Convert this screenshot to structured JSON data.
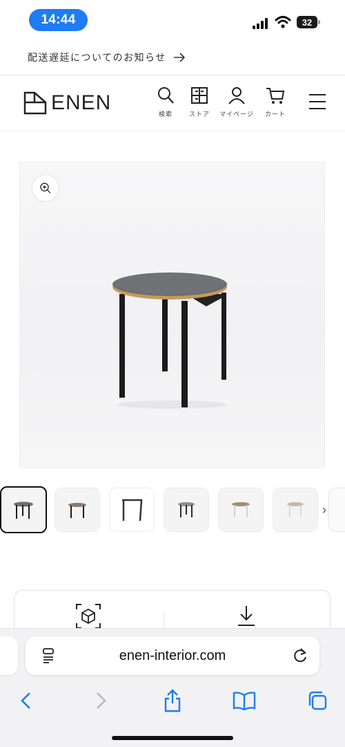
{
  "status_bar": {
    "time": "14:44",
    "battery_level": "32",
    "icons": [
      "cellular-signal-icon",
      "wifi-icon",
      "battery-icon"
    ]
  },
  "notice": {
    "text": "配送遅延についてのお知らせ",
    "icon": "arrow-right-icon"
  },
  "header": {
    "logo_text": "ENEN",
    "nav": [
      {
        "label": "検索",
        "icon": "search-icon"
      },
      {
        "label": "ストア",
        "icon": "store-icon"
      },
      {
        "label": "マイページ",
        "icon": "user-icon"
      },
      {
        "label": "カート",
        "icon": "cart-icon"
      }
    ],
    "menu_icon": "hamburger-menu-icon"
  },
  "product": {
    "zoom_icon": "zoom-in-icon",
    "thumbnail_count": 6,
    "active_thumbnail": 1,
    "thumb_next_icon": "chevron-right-icon"
  },
  "actions": {
    "ar_icon": "ar-view-cube-icon",
    "download_icon": "download-icon"
  },
  "browser": {
    "url": "enen-interior.com",
    "icons": [
      "reader-icon",
      "reload-icon",
      "back-icon",
      "forward-icon",
      "share-icon",
      "bookmarks-icon",
      "tabs-icon"
    ]
  },
  "colors": {
    "time_pill": "#1f7cf2",
    "safari_blue": "#1d7cf2",
    "tabletop": "#6b6d72",
    "tabletop_edge": "#c79a5a",
    "legs": "#1c1c1c"
  }
}
